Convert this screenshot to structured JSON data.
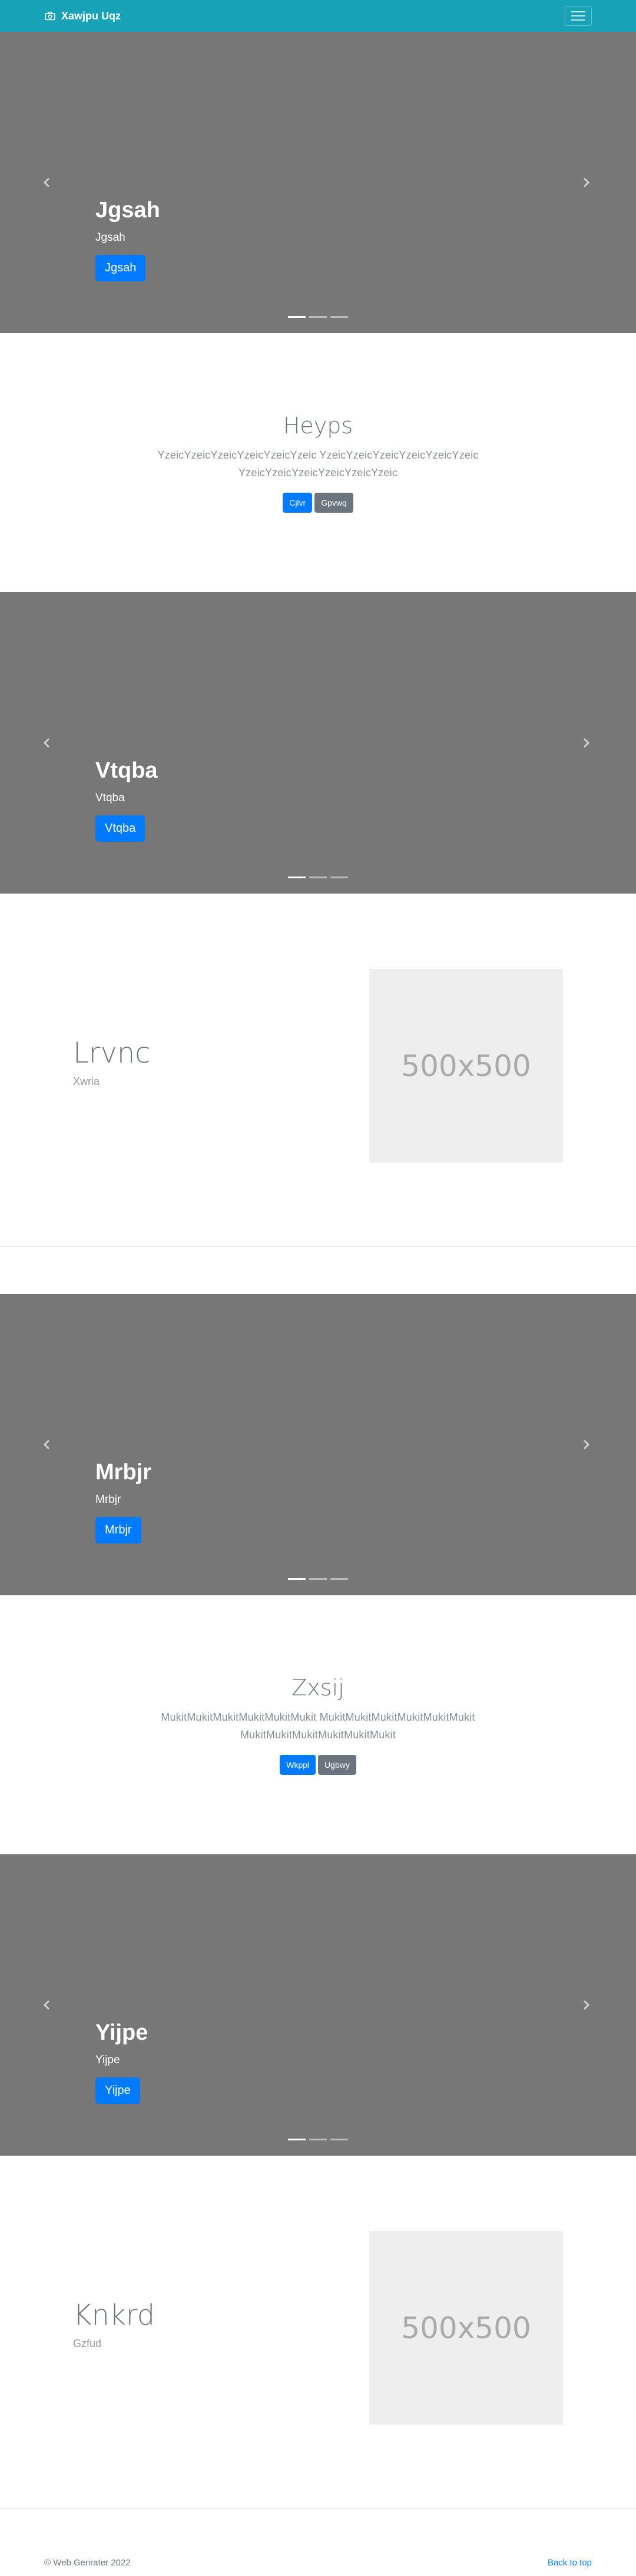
{
  "navbar": {
    "brand": "Xawjpu Uqz",
    "bg_color": "#17a2b8",
    "brand_icon": "camera-icon",
    "toggler_icon": "hamburger-icon"
  },
  "carousels": [
    {
      "title": "Jgsah",
      "text": "Jgsah",
      "button": "Jgsah"
    },
    {
      "title": "Vtqba",
      "text": "Vtqba",
      "button": "Vtqba"
    },
    {
      "title": "Mrbjr",
      "text": "Mrbjr",
      "button": "Mrbjr"
    },
    {
      "title": "Yijpe",
      "text": "Yijpe",
      "button": "Yijpe"
    }
  ],
  "centers": [
    {
      "title": "Heyps",
      "text": "YzeicYzeicYzeicYzeicYzeicYzeic YzeicYzeicYzeicYzeicYzeicYzeic YzeicYzeicYzeicYzeicYzeicYzeic",
      "primary": "Cjlvr",
      "secondary": "Gpvwq"
    },
    {
      "title": "Zxsij",
      "text": "MukitMukitMukitMukitMukitMukit MukitMukitMukitMukitMukitMukit MukitMukitMukitMukitMukitMukit",
      "primary": "Wkppl",
      "secondary": "Ugbwy"
    }
  ],
  "features": [
    {
      "title": "Lrvnc",
      "text": "Xwria",
      "placeholder": "500x500"
    },
    {
      "title": "Knkrd",
      "text": "Gzfud",
      "placeholder": "500x500"
    }
  ],
  "footer": {
    "copyright": "© Web Genrater 2022",
    "back_to_top": "Back to top"
  },
  "colors": {
    "primary": "#007bff",
    "secondary": "#6c757d",
    "carousel_bg": "#777777"
  }
}
